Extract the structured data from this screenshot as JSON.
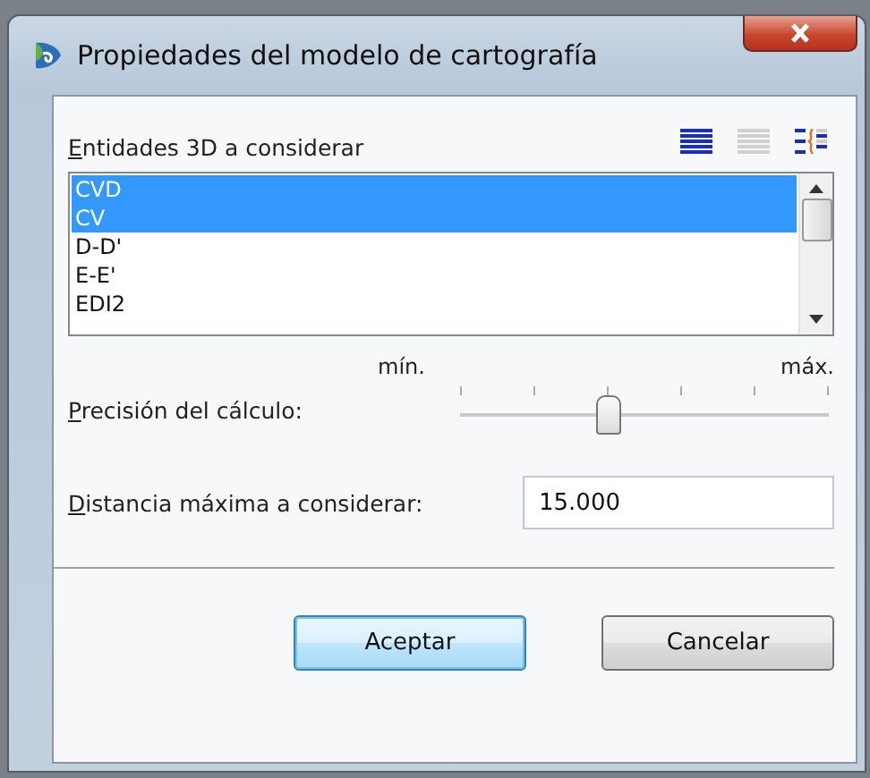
{
  "window": {
    "title": "Propiedades del modelo de cartografía"
  },
  "entities": {
    "label": "Entidades 3D a considerar",
    "items": [
      {
        "label": "CVD",
        "selected": true
      },
      {
        "label": "CV",
        "selected": true
      },
      {
        "label": "D-D'",
        "selected": false
      },
      {
        "label": "E-E'",
        "selected": false
      },
      {
        "label": "EDI2",
        "selected": false
      }
    ]
  },
  "precision": {
    "label": "Precisión del cálculo:",
    "min_label": "mín.",
    "max_label": "máx.",
    "level": 0.4
  },
  "distance": {
    "label": "Distancia máxima a considerar:",
    "value": "15.000"
  },
  "buttons": [
    {
      "label": "Aceptar",
      "default": true
    },
    {
      "label": "Cancelar",
      "default": false
    }
  ]
}
